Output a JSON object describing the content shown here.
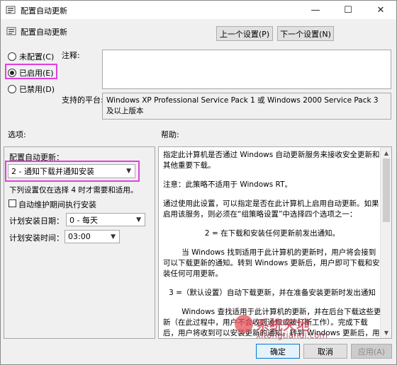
{
  "window": {
    "title": "配置自动更新",
    "minimize_glyph": "—",
    "maximize_glyph": "☐",
    "close_glyph": "✕"
  },
  "header": {
    "policy_title": "配置自动更新",
    "prev_button": "上一个设置(P)",
    "next_button": "下一个设置(N)"
  },
  "state_options": {
    "not_configured": "未配置(C)",
    "enabled": "已启用(E)",
    "disabled": "已禁用(D)",
    "selected": "enabled"
  },
  "comment": {
    "label": "注释:",
    "value": ""
  },
  "platform": {
    "label": "支持的平台:",
    "value": "Windows XP Professional Service Pack 1 或 Windows 2000 Service Pack 3 及以上版本"
  },
  "options": {
    "section_label": "选项:",
    "configure_label": "配置自动更新：",
    "configure_value": "2 - 通知下载并通知安装",
    "note": "下列设置仅在选择 4 时才需要和适用。",
    "maintenance_checkbox": "自动维护期间执行安装",
    "maintenance_checked": false,
    "schedule_day_label": "计划安装日期：",
    "schedule_day_value": "0 - 每天",
    "schedule_time_label": "计划安装时间：",
    "schedule_time_value": "03:00"
  },
  "help": {
    "section_label": "帮助:",
    "paragraphs": [
      "指定此计算机是否通过 Windows 自动更新服务来接收安全更新和其他重要下载。",
      "注意：此策略不适用于 Windows RT。",
      "通过使用此设置，可以指定是否在此计算机上启用自动更新。如果启用该服务，则必须在“组策略设置”中选择四个选项之一：",
      "2 = 在下载和安装任何更新前发出通知。",
      "当 Windows 找到适用于此计算机的更新时，用户将会接到可以下载更新的通知。转到 Windows 更新后，用户即可下载和安装任何可用更新。",
      "3 =（默认设置）自动下载更新，并在准备安装更新时发出通知",
      "Windows 查找适用于此计算机的更新，并在后台下载这些更新（在此过程中，用户不会收到通知或被打断工作）。完成下载后，用户将收到可以安装更新的通知。转到 Windows 更新后，用户即可安装更新。"
    ]
  },
  "footer": {
    "ok_button": "确定",
    "cancel_button": "取消",
    "apply_button": "应用(A)"
  },
  "watermark": {
    "text": "系统天地",
    "url": "xitongtiandi.com"
  }
}
